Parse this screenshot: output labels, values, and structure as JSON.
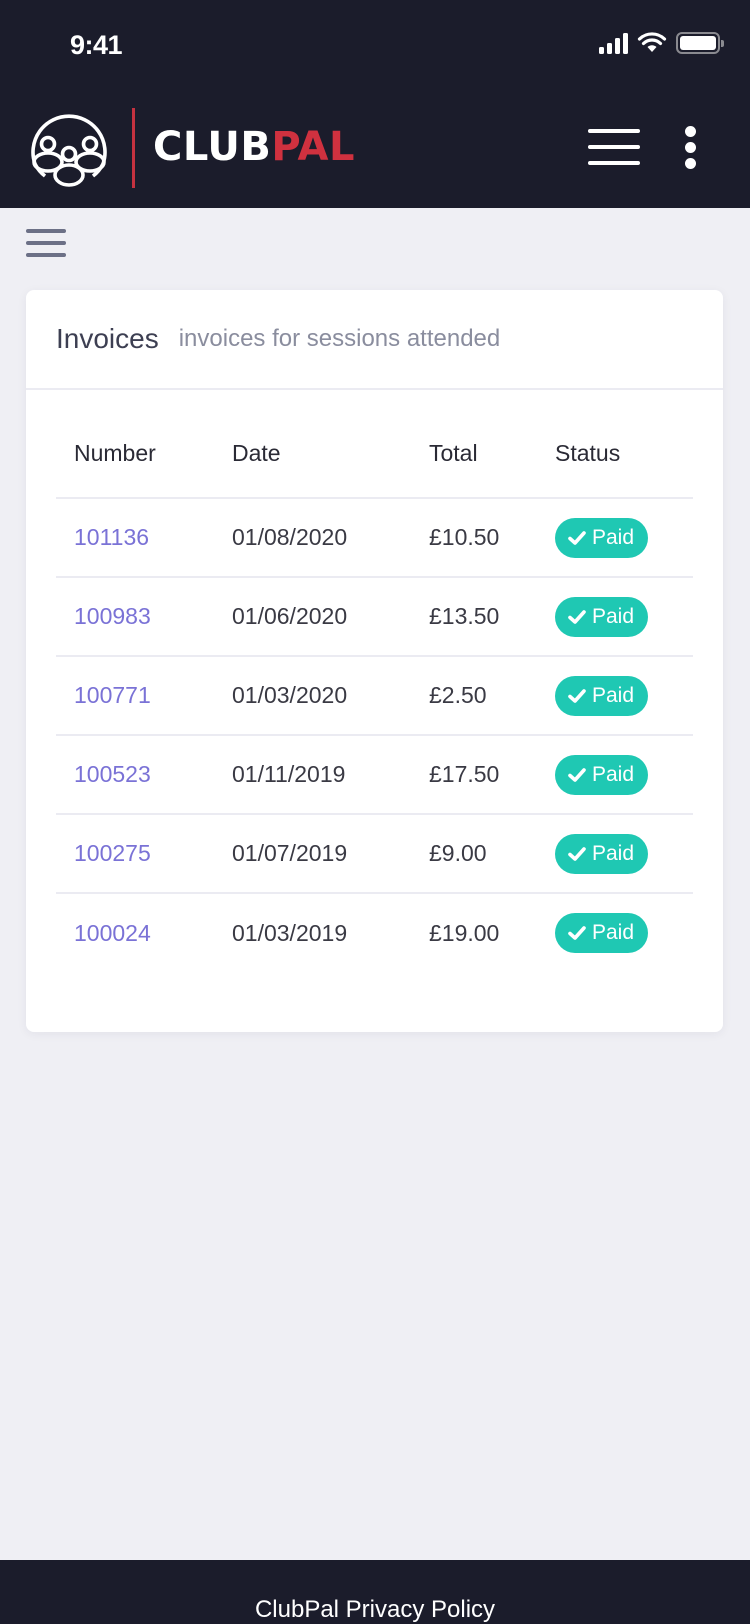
{
  "status_bar": {
    "time": "9:41",
    "icons": [
      "cellular-signal-icon",
      "wifi-icon",
      "battery-icon"
    ]
  },
  "header": {
    "brand_primary": "CLUB",
    "brand_accent": "PAL",
    "brand_accent_color": "#d0313f",
    "background_color": "#1b1c2b",
    "logo_icon": "group-people-icon",
    "menu_icon": "hamburger-menu-icon",
    "more_icon": "more-vertical-icon"
  },
  "sidebar_toggle": {
    "icon": "hamburger-menu-icon"
  },
  "invoices_card": {
    "title": "Invoices",
    "subtitle": "invoices for sessions attended",
    "columns": [
      "Number",
      "Date",
      "Total",
      "Status"
    ],
    "rows": [
      {
        "number": "101136",
        "date": "01/08/2020",
        "total": "£10.50",
        "status": "Paid"
      },
      {
        "number": "100983",
        "date": "01/06/2020",
        "total": "£13.50",
        "status": "Paid"
      },
      {
        "number": "100771",
        "date": "01/03/2020",
        "total": "£2.50",
        "status": "Paid"
      },
      {
        "number": "100523",
        "date": "01/11/2019",
        "total": "£17.50",
        "status": "Paid"
      },
      {
        "number": "100275",
        "date": "01/07/2019",
        "total": "£9.00",
        "status": "Paid"
      },
      {
        "number": "100024",
        "date": "01/03/2019",
        "total": "£19.00",
        "status": "Paid"
      }
    ],
    "link_color": "#7a72d6",
    "paid_badge_color": "#1fc8b3",
    "status_icon": "check-icon"
  },
  "footer": {
    "link_text": "ClubPal Privacy Policy"
  }
}
